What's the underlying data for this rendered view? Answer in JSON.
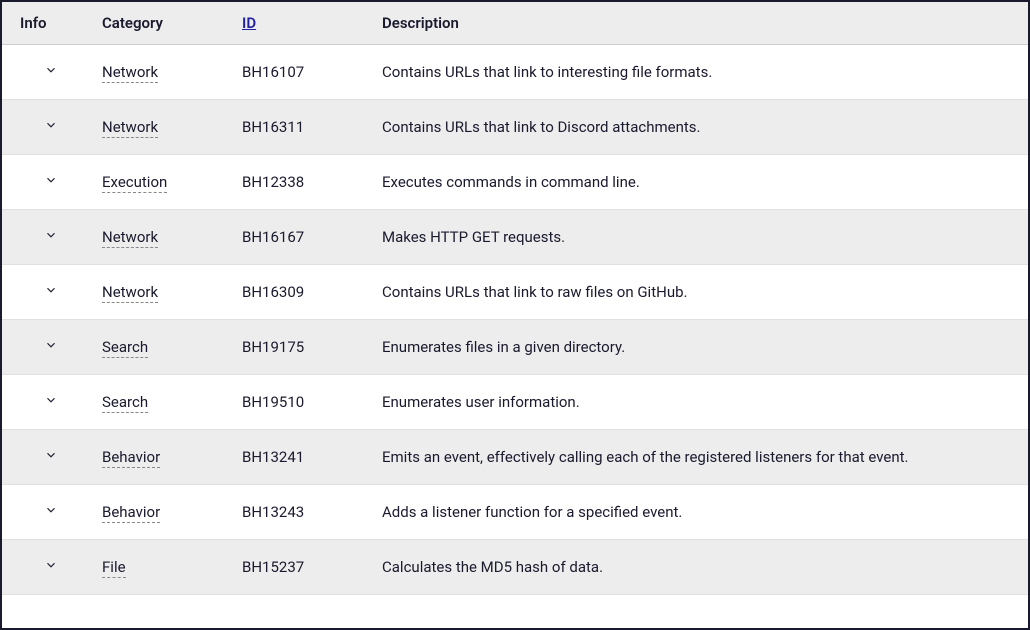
{
  "headers": {
    "info": "Info",
    "category": "Category",
    "id": "ID",
    "description": "Description"
  },
  "rows": [
    {
      "category": "Network",
      "id": "BH16107",
      "description": "Contains URLs that link to interesting file formats."
    },
    {
      "category": "Network",
      "id": "BH16311",
      "description": "Contains URLs that link to Discord attachments."
    },
    {
      "category": "Execution",
      "id": "BH12338",
      "description": "Executes commands in command line."
    },
    {
      "category": "Network",
      "id": "BH16167",
      "description": "Makes HTTP GET requests."
    },
    {
      "category": "Network",
      "id": "BH16309",
      "description": "Contains URLs that link to raw files on GitHub."
    },
    {
      "category": "Search",
      "id": "BH19175",
      "description": "Enumerates files in a given directory."
    },
    {
      "category": "Search",
      "id": "BH19510",
      "description": "Enumerates user information."
    },
    {
      "category": "Behavior",
      "id": "BH13241",
      "description": "Emits an event, effectively calling each of the registered listeners for that event."
    },
    {
      "category": "Behavior",
      "id": "BH13243",
      "description": "Adds a listener function for a specified event."
    },
    {
      "category": "File",
      "id": "BH15237",
      "description": "Calculates the MD5 hash of data."
    }
  ]
}
